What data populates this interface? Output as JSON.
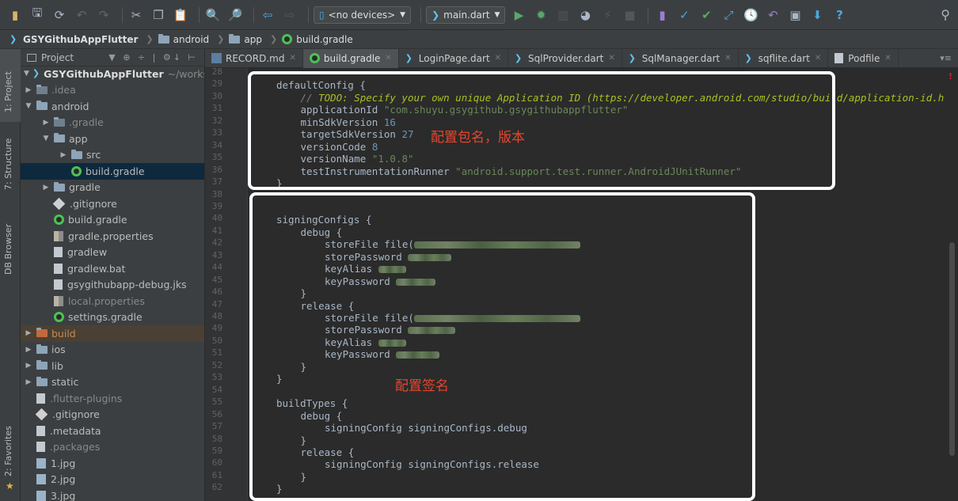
{
  "toolbar": {
    "device_combo": "<no devices>",
    "run_config": "main.dart",
    "help": "?"
  },
  "breadcrumb": [
    "GSYGithubAppFlutter",
    "android",
    "app",
    "build.gradle"
  ],
  "strip": {
    "project": "1: Project",
    "structure": "7: Structure",
    "db_browser": "DB Browser",
    "favorites": "2: Favorites"
  },
  "project_panel": {
    "title": "Project",
    "root_name": "GSYGithubAppFlutter",
    "root_path": "~/workspace",
    "items": [
      {
        "label": ".idea",
        "dim": true
      },
      {
        "label": "android"
      },
      {
        "label": ".gradle",
        "dim": true
      },
      {
        "label": "app"
      },
      {
        "label": "src"
      },
      {
        "label": "build.gradle"
      },
      {
        "label": "gradle"
      },
      {
        "label": ".gitignore"
      },
      {
        "label": "build.gradle"
      },
      {
        "label": "gradle.properties"
      },
      {
        "label": "gradlew"
      },
      {
        "label": "gradlew.bat"
      },
      {
        "label": "gsygithubapp-debug.jks"
      },
      {
        "label": "local.properties",
        "dim": true
      },
      {
        "label": "settings.gradle"
      },
      {
        "label": "build",
        "dim": true
      },
      {
        "label": "ios"
      },
      {
        "label": "lib"
      },
      {
        "label": "static"
      },
      {
        "label": ".flutter-plugins",
        "dim": true
      },
      {
        "label": ".gitignore"
      },
      {
        "label": ".metadata"
      },
      {
        "label": ".packages",
        "dim": true
      },
      {
        "label": "1.jpg"
      },
      {
        "label": "2.jpg"
      },
      {
        "label": "3.jpg"
      }
    ]
  },
  "tabs": [
    {
      "label": "RECORD.md"
    },
    {
      "label": "build.gradle",
      "active": true
    },
    {
      "label": "LoginPage.dart"
    },
    {
      "label": "SqlProvider.dart"
    },
    {
      "label": "SqlManager.dart"
    },
    {
      "label": "sqflite.dart"
    },
    {
      "label": "Podfile"
    }
  ],
  "line_numbers": [
    "28",
    "29",
    "30",
    "31",
    "32",
    "33",
    "34",
    "35",
    "36",
    "37",
    "38",
    "39",
    "40",
    "41",
    "42",
    "43",
    "44",
    "45",
    "46",
    "47",
    "48",
    "49",
    "50",
    "51",
    "52",
    "53",
    "54",
    "55",
    "56",
    "57",
    "58",
    "59",
    "60",
    "61",
    "62"
  ],
  "code": {
    "l29": "defaultConfig {",
    "l30_comment": "// ",
    "l30_todo": "TODO: Specify your own unique Application ID (https://developer.android.com/studio/build/application-id.h",
    "l31_key": "applicationId ",
    "l31_val": "\"com.shuyu.gsygithub.gsygithubappflutter\"",
    "l32_key": "minSdkVersion ",
    "l32_val": "16",
    "l33_key": "targetSdkVersion ",
    "l33_val": "27",
    "l34_key": "versionCode ",
    "l34_val": "8",
    "l35_key": "versionName ",
    "l35_val": "\"1.0.8\"",
    "l36_key": "testInstrumentationRunner ",
    "l36_val": "\"android.support.test.runner.AndroidJUnitRunner\"",
    "l37": "}",
    "l40": "signingConfigs {",
    "l41": "debug {",
    "l42": "storeFile file(",
    "l43": "storePassword ",
    "l44": "keyAlias ",
    "l45": "keyPassword ",
    "l46": "}",
    "l47": "release {",
    "l48": "storeFile file(",
    "l49": "storePassword ",
    "l50": "keyAlias ",
    "l51": "keyPassword ",
    "l52": "}",
    "l53": "}",
    "l55": "buildTypes {",
    "l56": "debug {",
    "l57": "signingConfig signingConfigs.debug",
    "l58": "}",
    "l59": "release {",
    "l60": "signingConfig signingConfigs.release",
    "l61": "}",
    "l62": "}"
  },
  "annotations": {
    "package_version": "配置包名，版本",
    "signing": "配置签名"
  },
  "colors": {
    "annotation": "#e8452c",
    "callout_border": "#ffffff",
    "string": "#6a8759",
    "number": "#6897bb",
    "todo": "#a8c023"
  }
}
